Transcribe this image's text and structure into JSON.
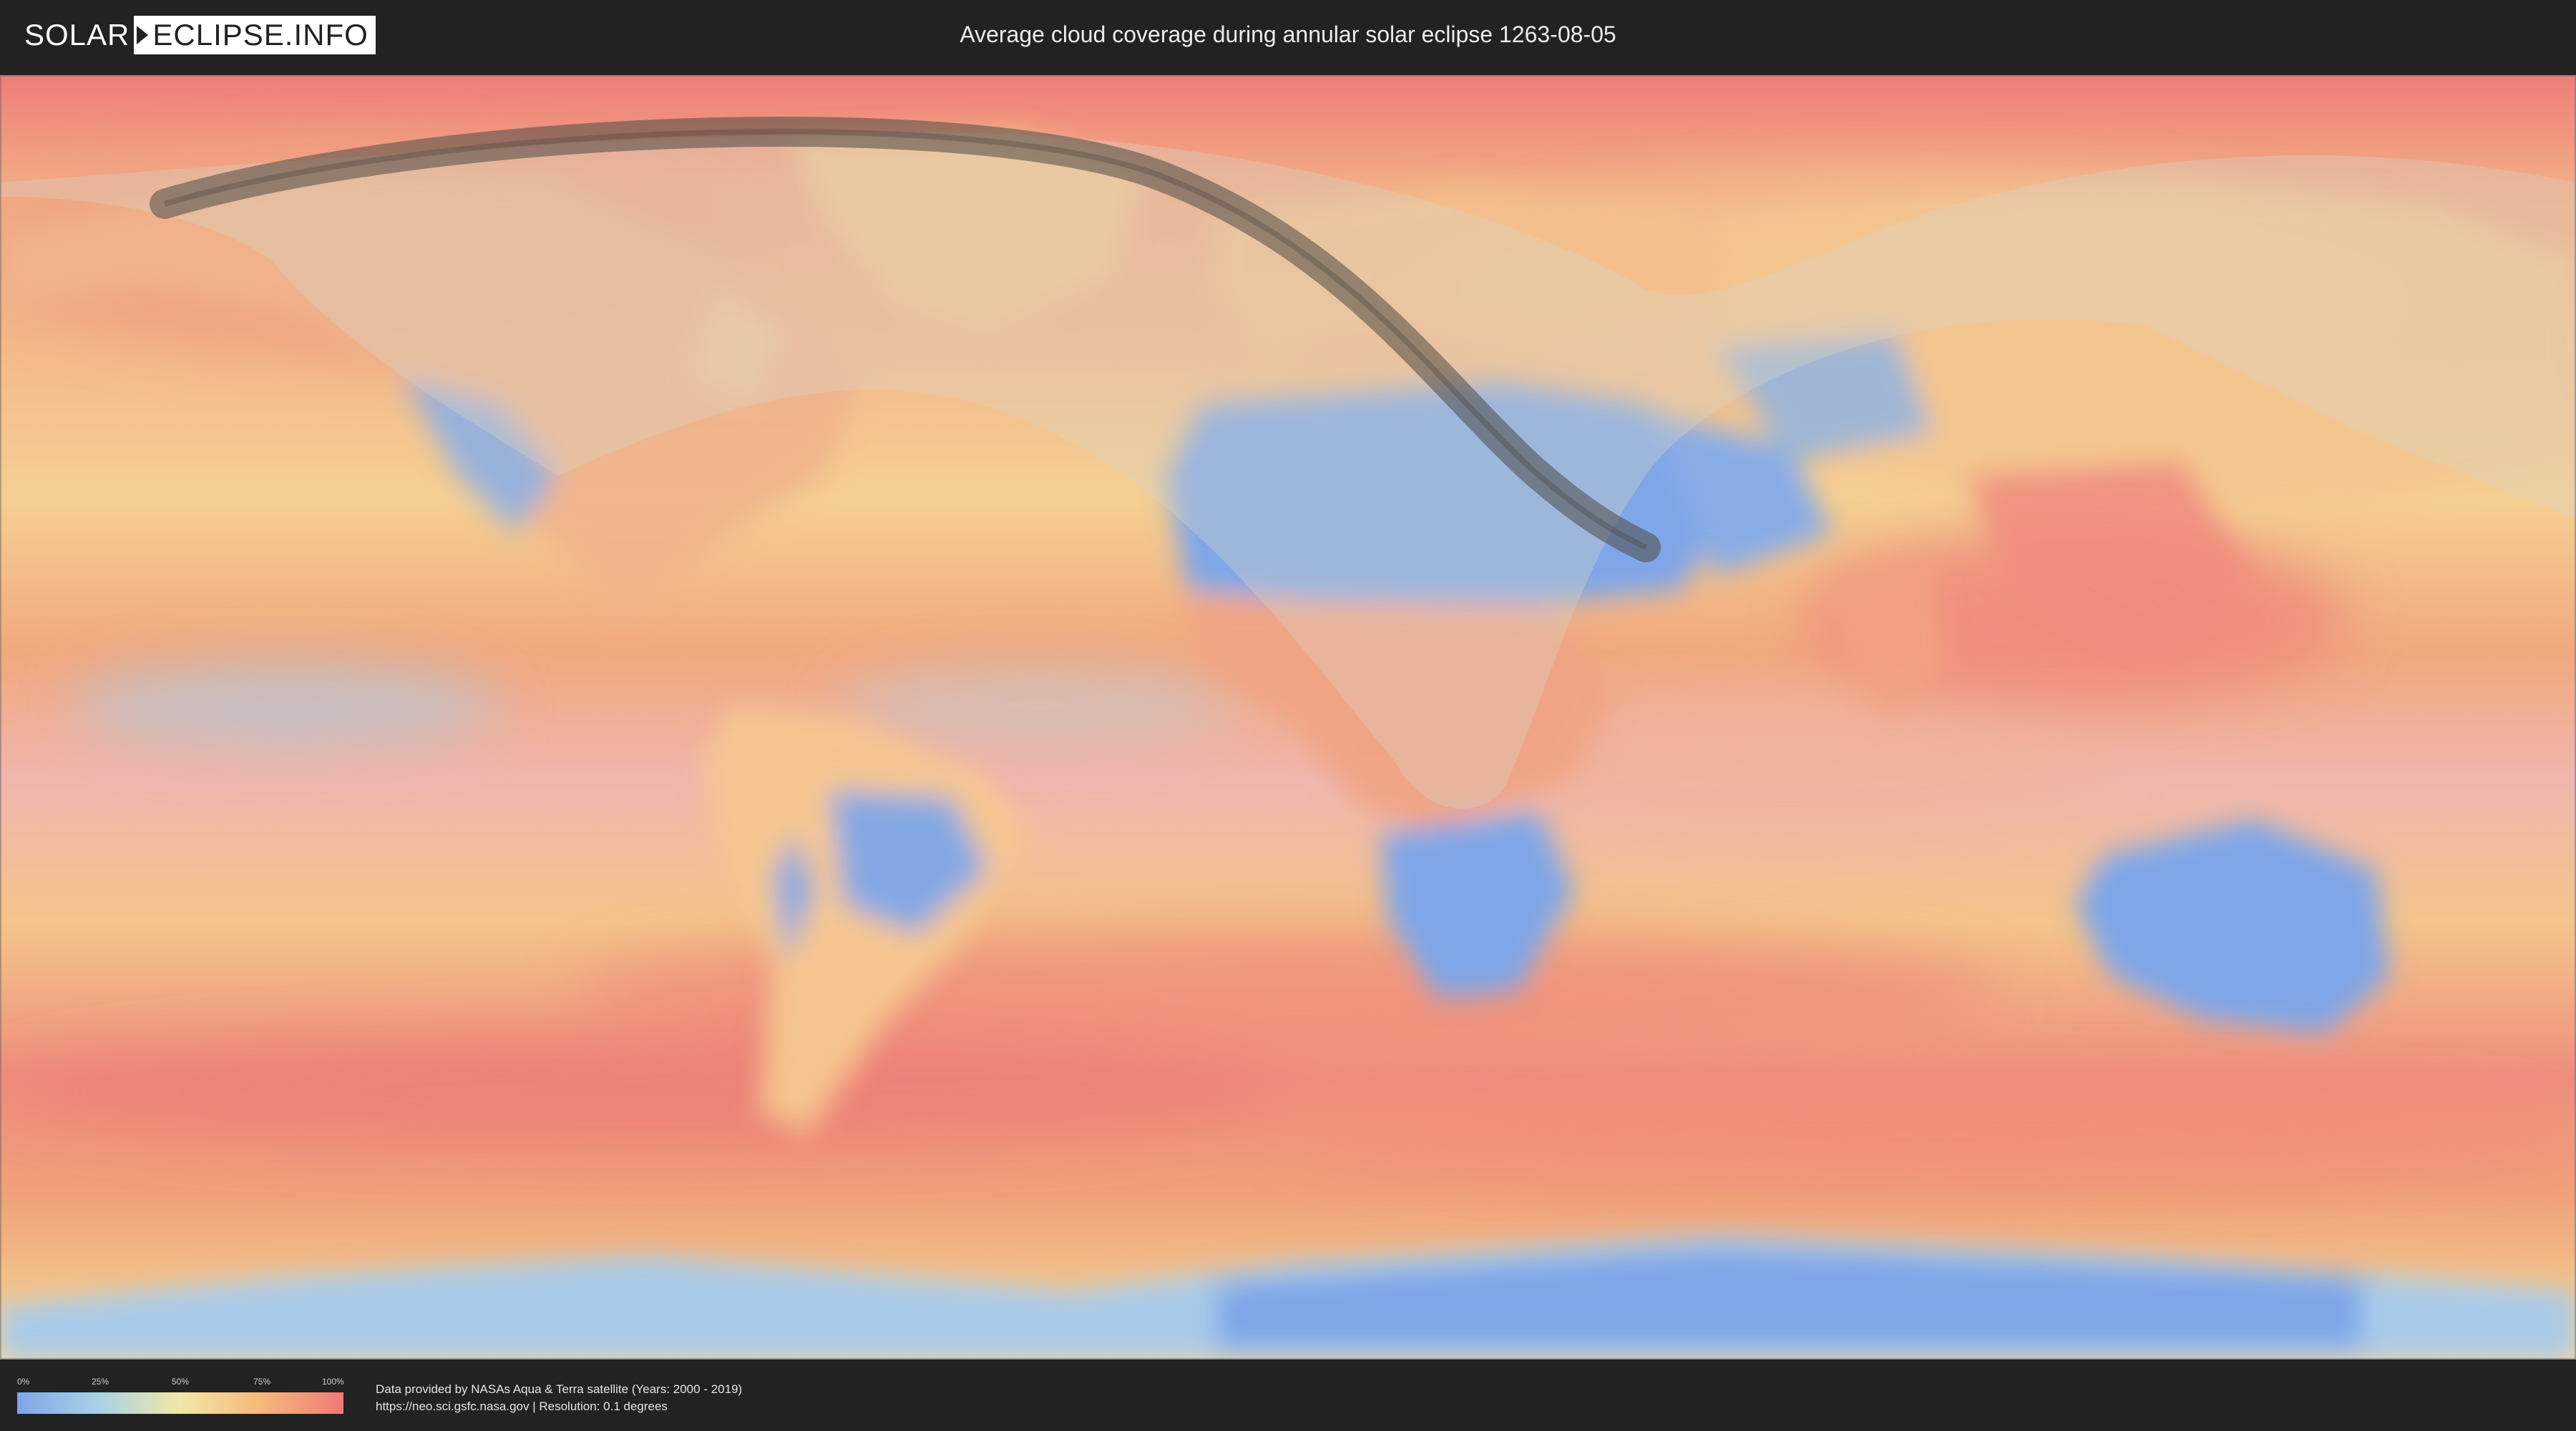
{
  "header": {
    "logo_left": "SOLAR",
    "logo_right": "ECLIPSE.INFO",
    "title": "Average cloud coverage during annular solar eclipse 1263-08-05"
  },
  "map": {
    "projection": "equirectangular",
    "content": "world map of average cloud coverage with eclipse visibility shadow and annularity path",
    "colors": {
      "background_cloudy": "#ef7f7a",
      "mid": "#f4c88a",
      "clear": "#7ea6e8",
      "path": "#55504b",
      "shadow": "#c9c6b5"
    }
  },
  "legend": {
    "ticks": [
      "0%",
      "25%",
      "50%",
      "75%",
      "100%"
    ],
    "colors": [
      "#7ea6e8",
      "#a8d2e6",
      "#f2e6a8",
      "#f5b87a",
      "#ef7a78"
    ]
  },
  "footer": {
    "credit_line1": "Data provided by NASAs Aqua & Terra satellite (Years: 2000 - 2019)",
    "credit_line2": "https://neo.sci.gsfc.nasa.gov | Resolution: 0.1 degrees"
  }
}
